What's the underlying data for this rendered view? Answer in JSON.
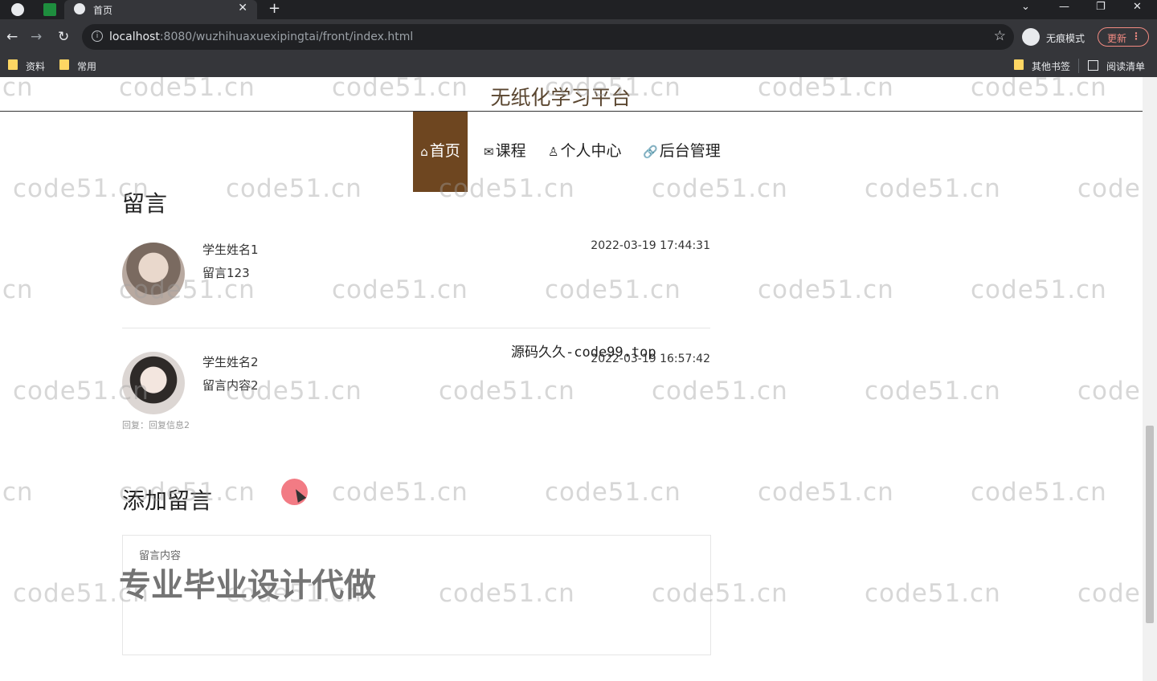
{
  "browser": {
    "tab_title": "首页",
    "new_tab": "+",
    "url_host": "localhost",
    "url_rest": ":8080/wuzhihuaxuexipingtai/front/index.html",
    "incognito_label": "无痕模式",
    "update_label": "更新",
    "more": "⋮",
    "bookmarks": [
      "资料",
      "常用"
    ],
    "bookmarks_right": [
      "其他书签",
      "阅读清单"
    ],
    "colors": {
      "tab_bg": "#35363a",
      "frame_bg": "#202124",
      "update": "#f28b82"
    }
  },
  "site": {
    "title": "无纸化学习平台",
    "nav": [
      {
        "icon": "⌂",
        "label": "首页",
        "active": true
      },
      {
        "icon": "✉",
        "label": "课程",
        "active": false
      },
      {
        "icon": "♙",
        "label": "个人中心",
        "active": false
      },
      {
        "icon": "🔗",
        "label": "后台管理",
        "active": false
      }
    ],
    "accent": "#6e4620"
  },
  "messages_section": {
    "title": "留言",
    "items": [
      {
        "name": "学生姓名1",
        "content": "留言123",
        "time": "2022-03-19 17:44:31",
        "reply": ""
      },
      {
        "name": "学生姓名2",
        "content": "留言内容2",
        "time": "2022-03-19 16:57:42",
        "reply": "回复：回复信息2"
      }
    ]
  },
  "add_section": {
    "title": "添加留言",
    "field_label": "留言内容"
  },
  "overlays": {
    "watermark": "code51.cn",
    "source_text": "源码久久-code99.top",
    "promo_text": "专业毕业设计代做"
  }
}
